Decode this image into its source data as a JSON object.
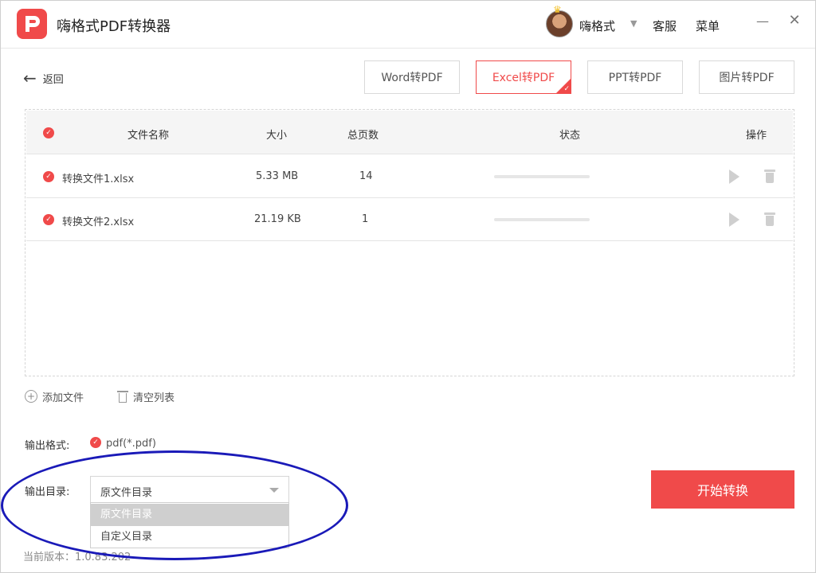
{
  "app": {
    "title": "嗨格式PDF转换器"
  },
  "user": {
    "name": "嗨格式"
  },
  "header": {
    "service": "客服",
    "menu": "菜单",
    "minimize": "—",
    "close": "✕"
  },
  "toolbar": {
    "back": "返回"
  },
  "tabs": [
    {
      "label": "Word转PDF",
      "active": false
    },
    {
      "label": "Excel转PDF",
      "active": true
    },
    {
      "label": "PPT转PDF",
      "active": false
    },
    {
      "label": "图片转PDF",
      "active": false
    }
  ],
  "table": {
    "headers": {
      "name": "文件名称",
      "size": "大小",
      "pages": "总页数",
      "status": "状态",
      "actions": "操作"
    },
    "rows": [
      {
        "name": "转换文件1.xlsx",
        "size": "5.33 MB",
        "pages": "14",
        "progress": 0
      },
      {
        "name": "转换文件2.xlsx",
        "size": "21.19 KB",
        "pages": "1",
        "progress": 0
      }
    ]
  },
  "list_actions": {
    "add": "添加文件",
    "clear": "清空列表"
  },
  "output": {
    "format_label": "输出格式:",
    "format_value": "pdf(*.pdf)",
    "dir_label": "输出目录:",
    "dir_value": "原文件目录",
    "dir_options": [
      "原文件目录",
      "自定义目录"
    ]
  },
  "start_button": "开始转换",
  "footer": {
    "version": "当前版本：1.0.83.202"
  },
  "colors": {
    "accent": "#f04a4a",
    "annotation": "#1a1ab8"
  }
}
